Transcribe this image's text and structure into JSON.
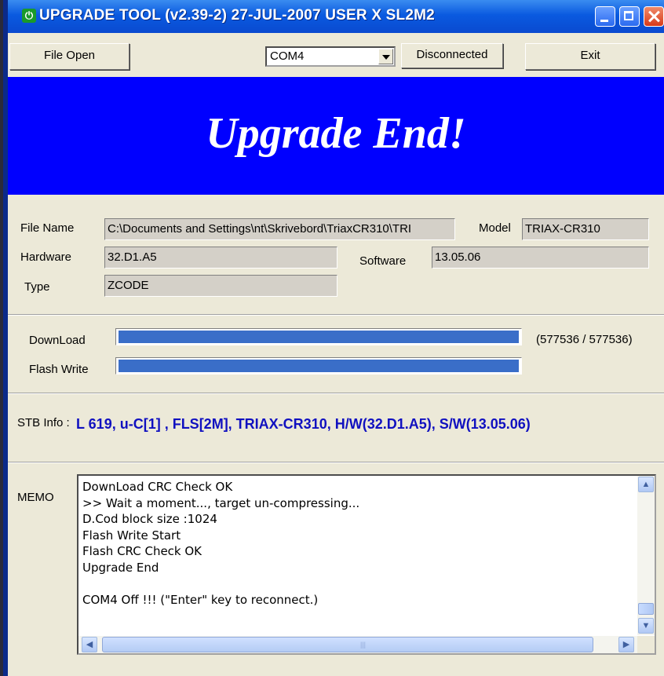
{
  "window": {
    "title": "UPGRADE TOOL (v2.39-2) 27-JUL-2007 USER X SL2M2"
  },
  "toolbar": {
    "file_open_label": "File Open",
    "port_selected": "COM4",
    "connection_label": "Disconnected",
    "exit_label": "Exit"
  },
  "banner": {
    "text": "Upgrade End!",
    "color": "#0000ff"
  },
  "info": {
    "file_name_label": "File Name",
    "file_name_value": "C:\\Documents and Settings\\nt\\Skrivebord\\TriaxCR310\\TRI",
    "model_label": "Model",
    "model_value": "TRIAX-CR310",
    "hardware_label": "Hardware",
    "hardware_value": "32.D1.A5",
    "software_label": "Software",
    "software_value": "13.05.06",
    "type_label": "Type",
    "type_value": "ZCODE"
  },
  "progress": {
    "download_label": "DownLoad",
    "download_fraction": 1.0,
    "download_count": "(577536 / 577536)",
    "flash_label": "Flash Write",
    "flash_fraction": 1.0,
    "fill_color": "#3a6ec8"
  },
  "stb": {
    "label": "STB Info :",
    "value": "L 619, u-C[1] , FLS[2M], TRIAX-CR310, H/W(32.D1.A5), S/W(13.05.06)",
    "color": "#1010c0"
  },
  "memo": {
    "label": "MEMO",
    "lines": [
      "DownLoad CRC Check OK",
      ">> Wait a moment..., target un-compressing...",
      "D.Cod block size :1024",
      "Flash Write Start",
      "Flash CRC Check OK",
      "Upgrade End",
      "",
      "COM4 Off !!! (\"Enter\" key to reconnect.)"
    ]
  }
}
